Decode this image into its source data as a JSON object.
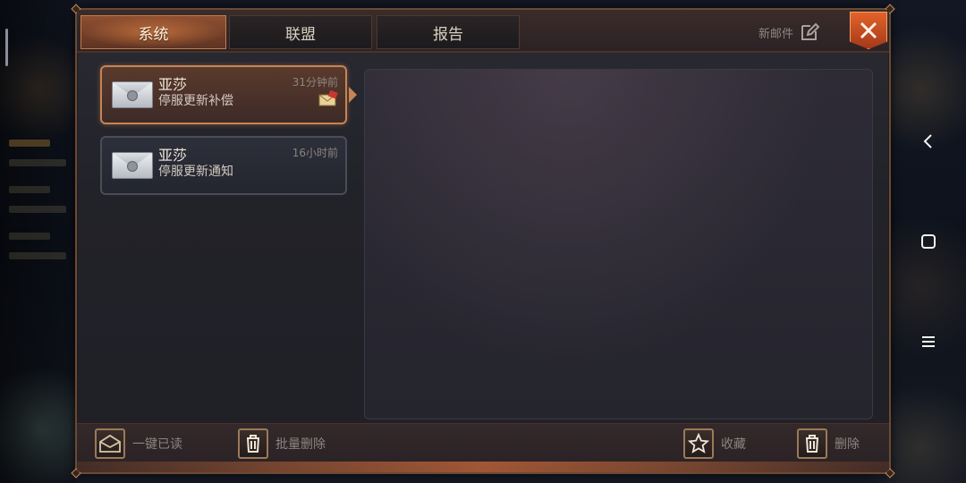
{
  "tabs": [
    {
      "label": "系统",
      "active": true
    },
    {
      "label": "联盟",
      "active": false
    },
    {
      "label": "报告",
      "active": false
    }
  ],
  "header": {
    "new_mail_label": "新邮件",
    "new_mail_icon": "edit-icon",
    "close_icon": "close-icon"
  },
  "mails": [
    {
      "sender": "亚莎",
      "subject": "停服更新补偿",
      "time": "31分钟前",
      "selected": true,
      "has_attachment": true
    },
    {
      "sender": "亚莎",
      "subject": "停服更新通知",
      "time": "16小时前",
      "selected": false,
      "has_attachment": false
    }
  ],
  "actions": {
    "read_all": "一键已读",
    "batch_delete": "批量删除",
    "favorite": "收藏",
    "delete": "删除"
  },
  "colors": {
    "accent": "#c68453",
    "close": "#e2632a",
    "tab_active": "#8e4f31"
  }
}
